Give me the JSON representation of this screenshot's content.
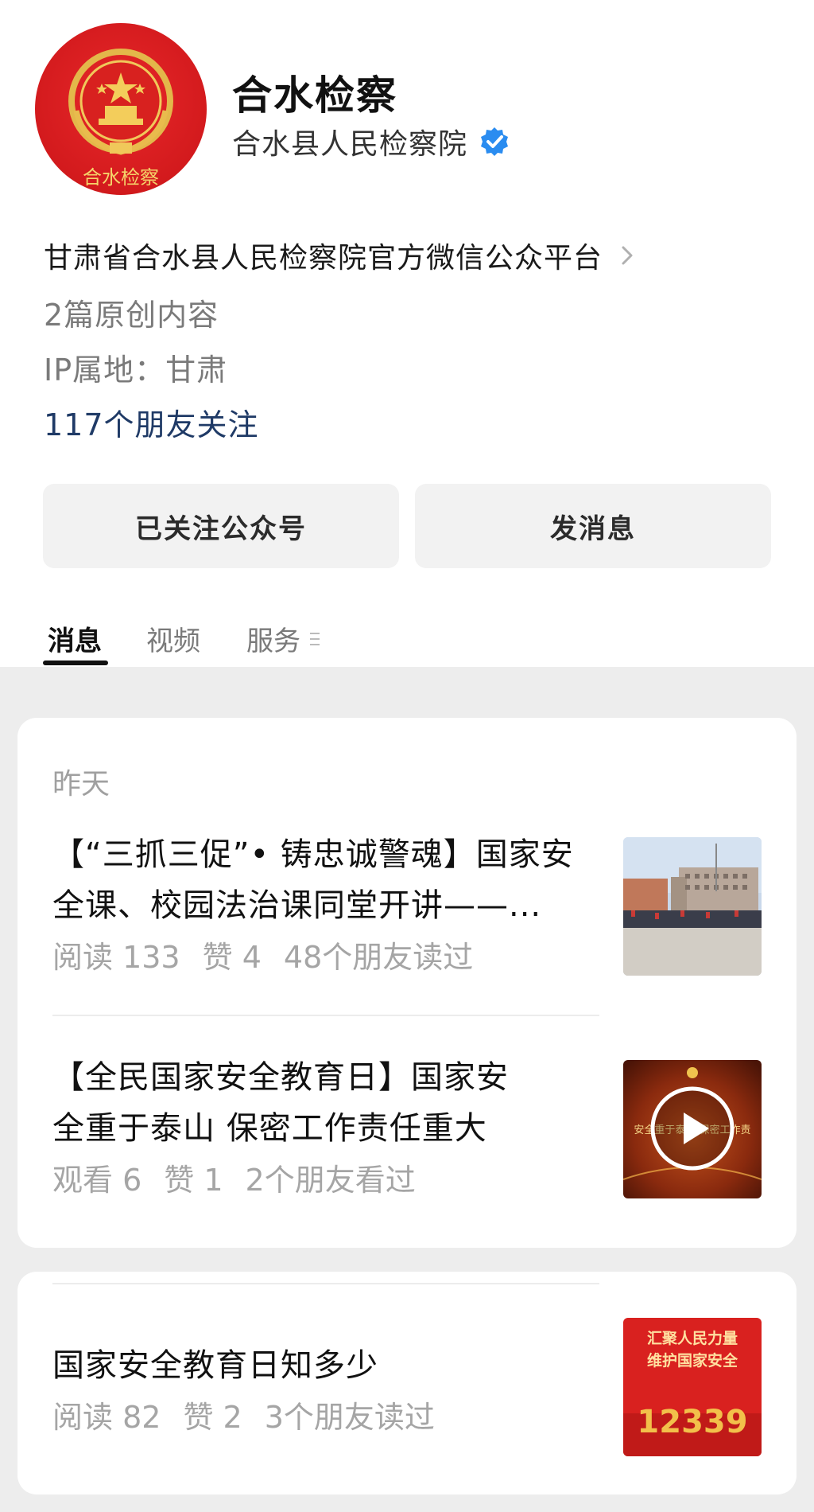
{
  "account": {
    "name": "合水检察",
    "organization": "合水县人民检察院",
    "avatar_text": "合水检察",
    "description": "甘肃省合水县人民检察院官方微信公众平台",
    "original_count": "2篇原创内容",
    "ip_location": "IP属地：甘肃",
    "friends_following": "117个朋友关注"
  },
  "buttons": {
    "followed": "已关注公众号",
    "message": "发消息"
  },
  "tabs": [
    {
      "label": "消息",
      "active": true
    },
    {
      "label": "视频",
      "active": false
    },
    {
      "label": "服务",
      "active": false
    }
  ],
  "feed": {
    "date_label": "昨天",
    "articles": [
      {
        "title_line1": "【“三抓三促”• 铸忠诚警魂】国家安",
        "title_line2": "全课、校园法治课同堂开讲——...",
        "stat1": "阅读 133",
        "stat2": "赞 4",
        "stat3": "48个朋友读过",
        "thumb_icon": "school-photo"
      },
      {
        "title_line1": "【全民国家安全教育日】国家安",
        "title_line2": "全重于泰山 保密工作责任重大",
        "stat1": "观看 6",
        "stat2": "赞 1",
        "stat3": "2个朋友看过",
        "thumb_icon": "video-play",
        "thumb_text": "安全重于泰山 保密工作责"
      },
      {
        "title_line1": "国家安全教育日知多少",
        "stat1": "阅读 82",
        "stat2": "赞 2",
        "stat3": "3个朋友读过",
        "thumb_icon": "poster",
        "thumb_line1": "汇聚人民力量",
        "thumb_line2": "维护国家安全",
        "thumb_number": "12339"
      }
    ]
  },
  "colors": {
    "brand_red": "#d31a1d",
    "verified_blue": "#2a8cf0",
    "link_blue": "#1f3a66"
  }
}
